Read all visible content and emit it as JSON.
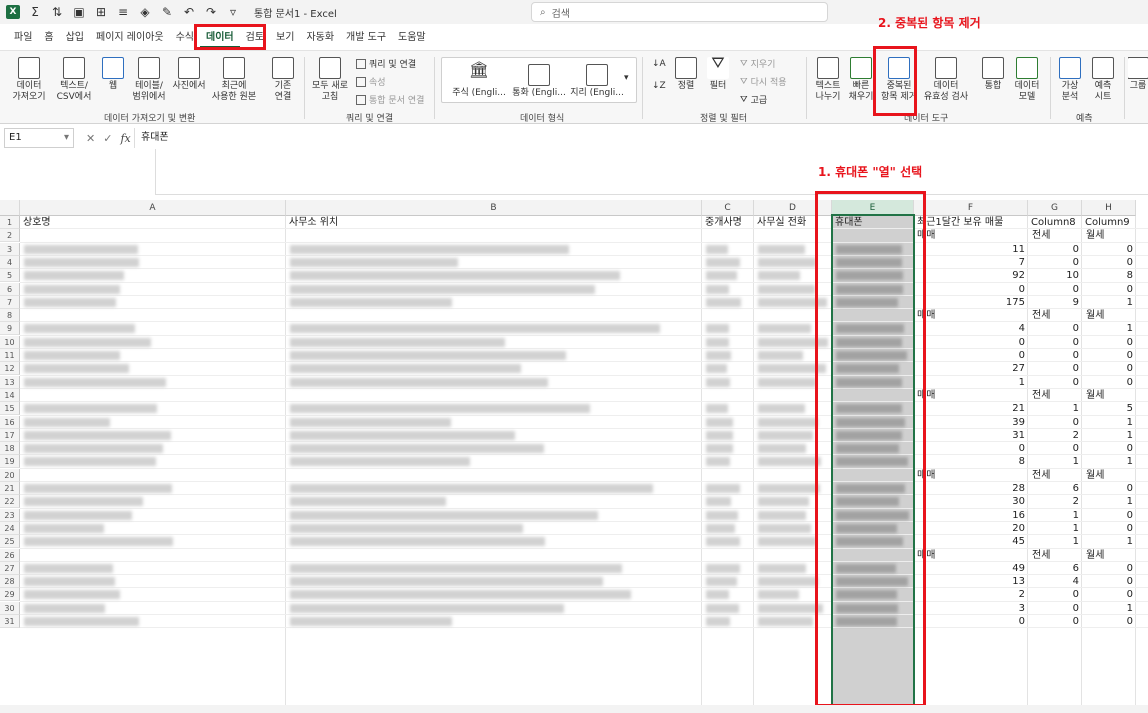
{
  "titlebar": {
    "app_icon": "excel-logo",
    "title": "통합 문서1 - Excel",
    "search_placeholder": "검색"
  },
  "menu_tabs": [
    "파일",
    "홈",
    "삽입",
    "페이지 레이아웃",
    "수식",
    "데이터",
    "검토",
    "보기",
    "자동화",
    "개발 도구",
    "도움말"
  ],
  "active_tab": "데이터",
  "ribbon": {
    "get_data": {
      "btn_data": "데이터\n가져오기",
      "btn_text_csv": "텍스트/\nCSV에서",
      "btn_web": "웹",
      "btn_table": "테이블/\n범위에서",
      "btn_picture": "사진에서",
      "btn_recent": "최근에\n사용한 원본",
      "btn_existing": "기존\n연결",
      "group_label": "데이터 가져오기 및 변환"
    },
    "queries": {
      "btn_refresh_all": "모두 새로\n고침",
      "queries_connections": "쿼리 및 연결",
      "properties": "속성",
      "workbook_links": "통합 문서 연결",
      "group_label": "쿼리 및 연결"
    },
    "data_types": {
      "stocks": "주식 (Engli...",
      "currency": "통화 (Engli...",
      "geography": "지리 (Engli...",
      "group_label": "데이터 형식"
    },
    "sort_filter": {
      "sort": "정렬",
      "filter": "필터",
      "clear": "지우기",
      "reapply": "다시 적용",
      "advanced": "고급",
      "group_label": "정렬 및 필터"
    },
    "data_tools": {
      "text_to_columns": "텍스트\n나누기",
      "flash_fill": "빠른\n채우기",
      "remove_duplicates": "중복된\n항목 제거",
      "data_validation": "데이터\n유효성 검사",
      "consolidate": "통합",
      "data_model": "데이터\n모델",
      "group_label": "데이터 도구"
    },
    "forecast": {
      "what_if": "가상\n분석",
      "forecast_sheet": "예측\n시트",
      "group_label": "예측"
    },
    "outline": {
      "group": "그룹"
    }
  },
  "formula_bar": {
    "name_box": "E1",
    "fx": "fx",
    "value": "휴대폰"
  },
  "columns": [
    {
      "letter": "A",
      "header": "상호명"
    },
    {
      "letter": "B",
      "header": "사무소 위치"
    },
    {
      "letter": "C",
      "header": "중개사명"
    },
    {
      "letter": "D",
      "header": "사무실 전화"
    },
    {
      "letter": "E",
      "header": "휴대폰"
    },
    {
      "letter": "F",
      "header": "최근1달간 보유 매물"
    },
    {
      "letter": "G",
      "header": "Column8"
    },
    {
      "letter": "H",
      "header": "Column9"
    }
  ],
  "rows": [
    {
      "n": "1",
      "f": "",
      "g": "",
      "h": ""
    },
    {
      "n": "2",
      "f": "매매",
      "g": "전세",
      "h": "월세"
    },
    {
      "n": "3",
      "f": "11",
      "g": "0",
      "h": "0"
    },
    {
      "n": "4",
      "f": "7",
      "g": "0",
      "h": "0"
    },
    {
      "n": "5",
      "f": "92",
      "g": "10",
      "h": "8"
    },
    {
      "n": "6",
      "f": "0",
      "g": "0",
      "h": "0"
    },
    {
      "n": "7",
      "f": "175",
      "g": "9",
      "h": "1"
    },
    {
      "n": "8",
      "f": "매매",
      "g": "전세",
      "h": "월세"
    },
    {
      "n": "9",
      "f": "4",
      "g": "0",
      "h": "1"
    },
    {
      "n": "10",
      "f": "0",
      "g": "0",
      "h": "0"
    },
    {
      "n": "11",
      "f": "0",
      "g": "0",
      "h": "0"
    },
    {
      "n": "12",
      "f": "27",
      "g": "0",
      "h": "0"
    },
    {
      "n": "13",
      "f": "1",
      "g": "0",
      "h": "0"
    },
    {
      "n": "14",
      "f": "매매",
      "g": "전세",
      "h": "월세"
    },
    {
      "n": "15",
      "f": "21",
      "g": "1",
      "h": "5"
    },
    {
      "n": "16",
      "f": "39",
      "g": "0",
      "h": "1"
    },
    {
      "n": "17",
      "f": "31",
      "g": "2",
      "h": "1"
    },
    {
      "n": "18",
      "f": "0",
      "g": "0",
      "h": "0"
    },
    {
      "n": "19",
      "f": "8",
      "g": "1",
      "h": "1"
    },
    {
      "n": "20",
      "f": "매매",
      "g": "전세",
      "h": "월세"
    },
    {
      "n": "21",
      "f": "28",
      "g": "6",
      "h": "0"
    },
    {
      "n": "22",
      "f": "30",
      "g": "2",
      "h": "1"
    },
    {
      "n": "23",
      "f": "16",
      "g": "1",
      "h": "0"
    },
    {
      "n": "24",
      "f": "20",
      "g": "1",
      "h": "0"
    },
    {
      "n": "25",
      "f": "45",
      "g": "1",
      "h": "1"
    },
    {
      "n": "26",
      "f": "매매",
      "g": "전세",
      "h": "월세"
    },
    {
      "n": "27",
      "f": "49",
      "g": "6",
      "h": "0"
    },
    {
      "n": "28",
      "f": "13",
      "g": "4",
      "h": "0"
    },
    {
      "n": "29",
      "f": "2",
      "g": "0",
      "h": "0"
    },
    {
      "n": "30",
      "f": "3",
      "g": "0",
      "h": "1"
    },
    {
      "n": "31",
      "f": "0",
      "g": "0",
      "h": "0"
    }
  ],
  "annotations": {
    "step1": "1. 휴대폰 \"열\" 선택",
    "step2": "2. 중복된 항목 제거"
  },
  "colors": {
    "accent": "#217346",
    "annotation": "#e8141c"
  }
}
